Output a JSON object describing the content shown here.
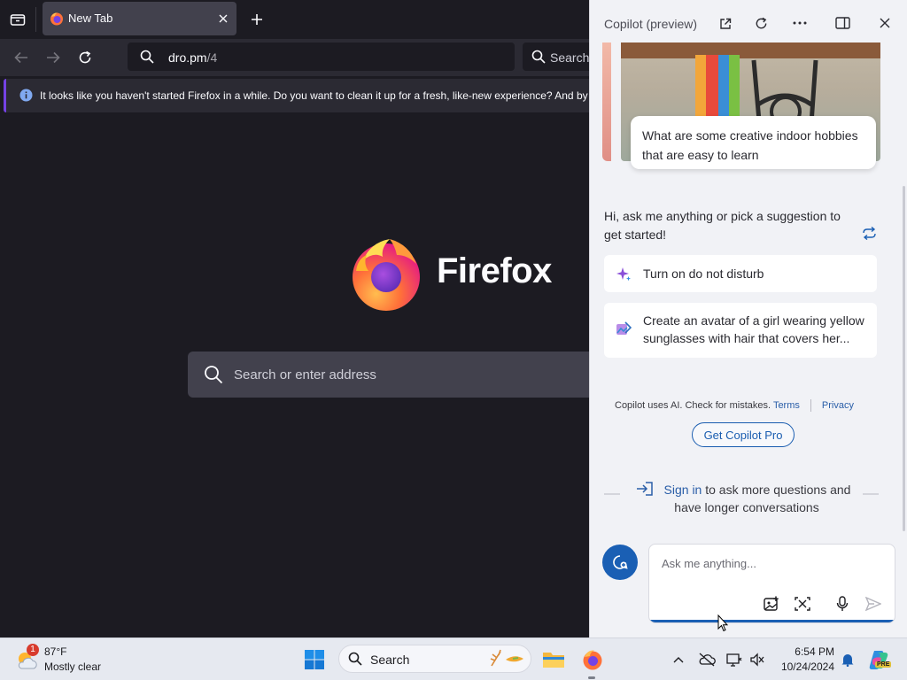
{
  "firefox": {
    "tab_title": "New Tab",
    "url_host": "dro.pm",
    "url_path": "/4",
    "search_label": "Search",
    "notification": "It looks like you haven't started Firefox in a while. Do you want to clean it up for a fresh, like-new experience? And by the way",
    "brand_wordmark": "Firefox",
    "main_search_placeholder": "Search or enter address",
    "icons": [
      "tabs-list-icon",
      "new-tab-icon",
      "close-tab-icon",
      "back-icon",
      "forward-icon",
      "reload-icon",
      "search-icon",
      "info-icon"
    ]
  },
  "copilot": {
    "title": "Copilot (preview)",
    "suggestion_card": "What are some creative indoor hobbies that are easy to learn",
    "greeting": "Hi, ask me anything or pick a suggestion to get started!",
    "suggestions": [
      {
        "label": "Turn on do not disturb",
        "icon": "sparkle-icon"
      },
      {
        "label": "Create an avatar of a girl wearing yellow sunglasses with hair that covers her...",
        "icon": "image-create-icon"
      }
    ],
    "disclaimer": "Copilot uses AI. Check for mistakes.",
    "terms_label": "Terms",
    "privacy_label": "Privacy",
    "pro_button": "Get Copilot Pro",
    "signin_link": "Sign in",
    "signin_rest": "to ask more questions and have longer conversations",
    "composer_placeholder": "Ask me anything...",
    "accent": "#1a5fb4"
  },
  "taskbar": {
    "weather_badge": "1",
    "weather_temp": "87°F",
    "weather_condition": "Mostly clear",
    "search_label": "Search",
    "time": "6:54 PM",
    "date": "10/24/2024"
  }
}
